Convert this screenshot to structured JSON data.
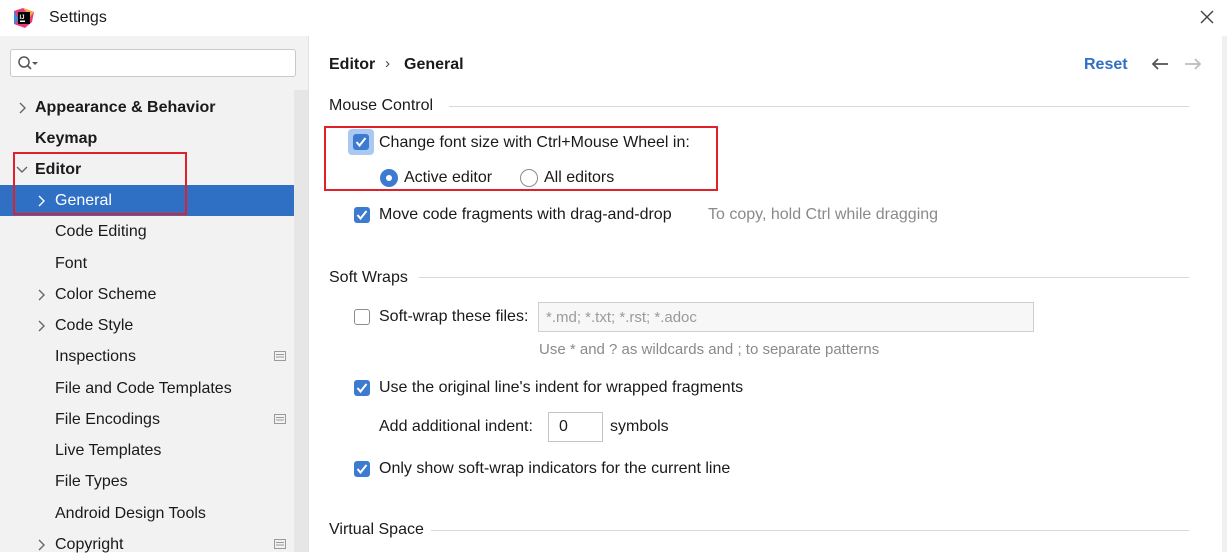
{
  "window": {
    "title": "Settings"
  },
  "sidebar": {
    "search": {
      "placeholder": "",
      "value": ""
    },
    "items": [
      {
        "label": "Appearance & Behavior"
      },
      {
        "label": "Keymap"
      },
      {
        "label": "Editor"
      },
      {
        "label": "General"
      },
      {
        "label": "Code Editing"
      },
      {
        "label": "Font"
      },
      {
        "label": "Color Scheme"
      },
      {
        "label": "Code Style"
      },
      {
        "label": "Inspections"
      },
      {
        "label": "File and Code Templates"
      },
      {
        "label": "File Encodings"
      },
      {
        "label": "Live Templates"
      },
      {
        "label": "File Types"
      },
      {
        "label": "Android Design Tools"
      },
      {
        "label": "Copyright"
      }
    ]
  },
  "header": {
    "breadcrumb": [
      "Editor",
      "General"
    ],
    "separator": "›",
    "reset_label": "Reset"
  },
  "mouse_control": {
    "title": "Mouse Control",
    "change_font_size": {
      "label": "Change font size with Ctrl+Mouse Wheel in:",
      "checked": true
    },
    "radio_active_editor": {
      "label": "Active editor",
      "selected": true
    },
    "radio_all_editors": {
      "label": "All editors",
      "selected": false
    },
    "move_code": {
      "label": "Move code fragments with drag-and-drop",
      "checked": true,
      "hint": "To copy, hold Ctrl while dragging"
    }
  },
  "soft_wraps": {
    "title": "Soft Wraps",
    "soft_wrap_files": {
      "label": "Soft-wrap these files:",
      "checked": false,
      "value": "*.md; *.txt; *.rst; *.adoc"
    },
    "wildcard_hint": "Use * and ? as wildcards and ; to separate patterns",
    "use_original_indent": {
      "label": "Use the original line's indent for wrapped fragments",
      "checked": true
    },
    "additional_indent": {
      "label": "Add additional indent:",
      "value": "0",
      "unit": "symbols"
    },
    "only_show_indicators": {
      "label": "Only show soft-wrap indicators for the current line",
      "checked": true
    }
  },
  "virtual_space": {
    "title": "Virtual Space"
  },
  "colors": {
    "accent": "#2f6fc4",
    "checkbox": "#3d7bd1",
    "highlight_box": "#e0202a",
    "sidebar_bg": "#f2f2f2"
  }
}
